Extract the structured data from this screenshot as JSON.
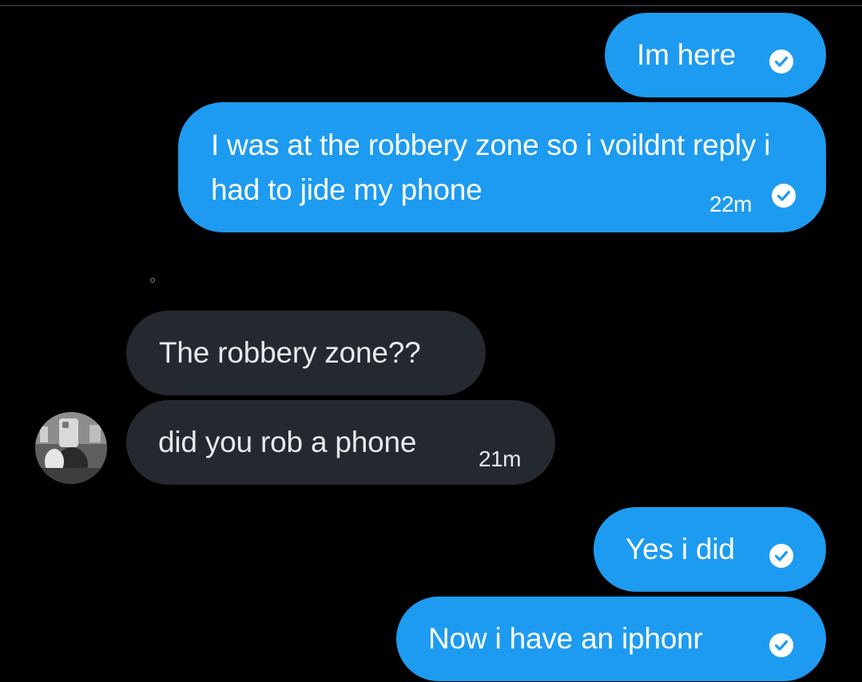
{
  "colors": {
    "sent_bubble": "#1d9bf0",
    "received_bubble": "#23292f",
    "background": "#000000"
  },
  "messages": [
    {
      "direction": "sent",
      "text": "Im here",
      "status_icon": "sent-check-icon"
    },
    {
      "direction": "sent",
      "text": "I was at the robbery zone so i voildnt reply i had to jide my phone",
      "time": "22m",
      "status_icon": "sent-check-icon"
    },
    {
      "direction": "received",
      "text": "The robbery zone??"
    },
    {
      "direction": "received",
      "text": "did you rob a phone",
      "time": "21m",
      "avatar": "profile-avatar"
    },
    {
      "direction": "sent",
      "text": "Yes i did",
      "status_icon": "sent-check-icon"
    },
    {
      "direction": "sent",
      "text": "Now i have an iphonr",
      "status_icon": "sent-check-icon"
    }
  ]
}
